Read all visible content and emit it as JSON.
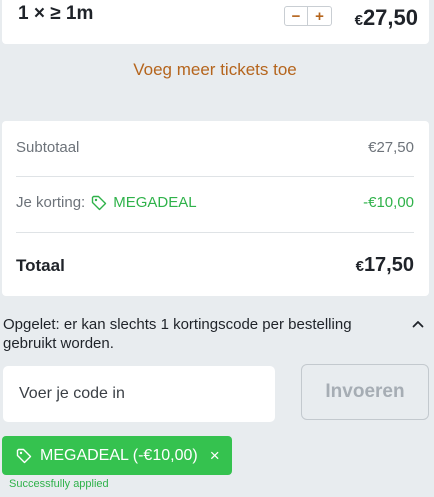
{
  "ticket": {
    "quantity_label": "1 × ≥ 1m",
    "minus_label": "−",
    "plus_label": "+",
    "currency": "€",
    "price": "27,50"
  },
  "add_tickets_label": "Voeg meer tickets toe",
  "summary": {
    "subtotal_label": "Subtotaal",
    "subtotal_value": "€27,50",
    "discount_label": "Je korting:",
    "discount_code": "MEGADEAL",
    "discount_value": "-€10,00",
    "total_label": "Totaal",
    "total_currency": "€",
    "total_value": "17,50"
  },
  "notice": "Opgelet: er kan slechts 1 kortingscode per bestelling gebruikt worden.",
  "code_input": {
    "placeholder": "Voer je code in",
    "value": ""
  },
  "apply_button_label": "Invoeren",
  "applied_chip": {
    "label": "MEGADEAL (-€10,00)",
    "close_label": "×"
  },
  "success_message": "Successfully applied",
  "colors": {
    "accent": "#b5651d",
    "success": "#2fb24a",
    "chip_bg": "#35c24f",
    "background": "#e8ecef"
  },
  "icons": [
    "tag-icon",
    "chevron-up-icon",
    "close-icon"
  ]
}
